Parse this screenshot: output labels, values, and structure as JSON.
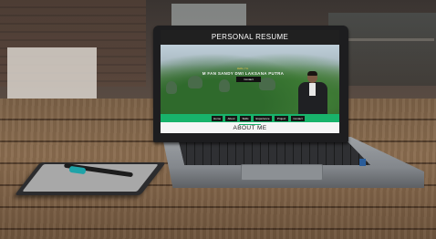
{
  "website": {
    "header_title": "PERSONAL RESUME",
    "hero_subtitle": "Hello, I'm",
    "hero_name": "M FAN SANDY DWI LAKSANA PUTRA",
    "hero_button": "Contact",
    "nav_items": [
      "Home",
      "About",
      "Skills",
      "Experience",
      "Project",
      "Contact"
    ],
    "section_title": "ABOUT ME"
  },
  "colors": {
    "header_bg": "#202020",
    "nav_accent": "#18b36b",
    "table_wood": "#7b6147",
    "laptop_body": "#9da1a5"
  }
}
